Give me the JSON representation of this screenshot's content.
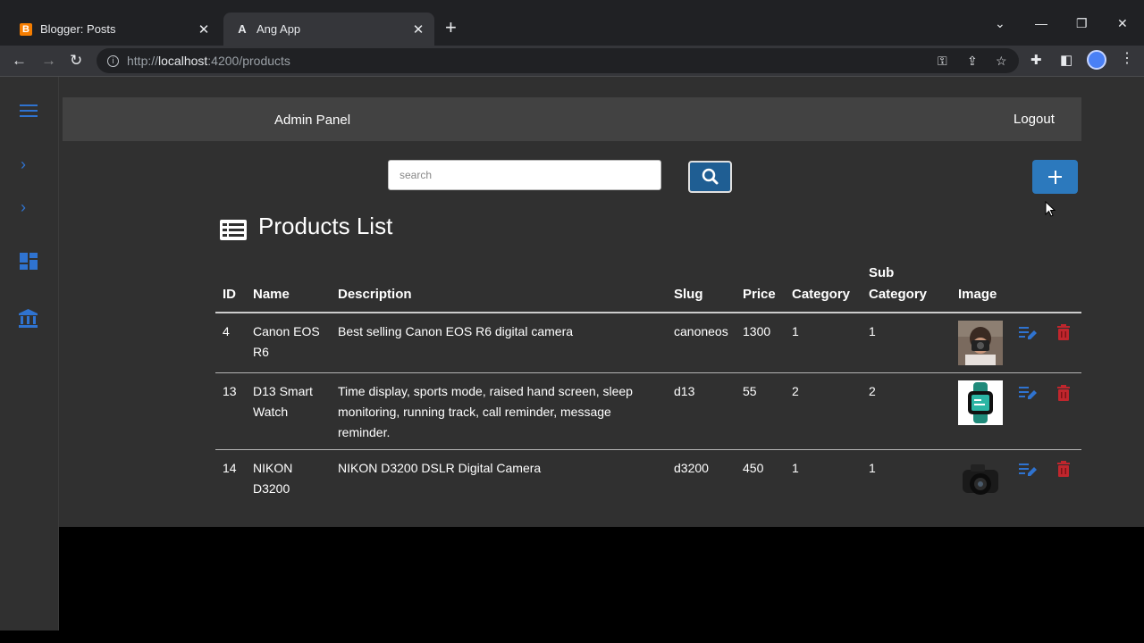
{
  "browser": {
    "tabs": [
      {
        "title": "Blogger: Posts",
        "favicon": "blogger-icon",
        "favicon_letter": "B",
        "active": false
      },
      {
        "title": "Ang App",
        "favicon": "angular-icon",
        "favicon_letter": "A",
        "active": true
      }
    ],
    "url": {
      "prefix": "http://",
      "host": "localhost",
      "rest": ":4200/products"
    }
  },
  "header": {
    "title": "Admin Panel",
    "logout": "Logout"
  },
  "search": {
    "placeholder": "search"
  },
  "page": {
    "title": "Products List"
  },
  "table": {
    "headers": {
      "id": "ID",
      "name": "Name",
      "description": "Description",
      "slug": "Slug",
      "price": "Price",
      "category": "Category",
      "subcategory_line1": "Sub",
      "subcategory_line2": "Category",
      "image": "Image"
    },
    "rows": [
      {
        "id": "4",
        "name": "Canon EOS R6",
        "description": "Best selling Canon EOS R6 digital camera",
        "slug": "canoneos",
        "price": "1300",
        "category": "1",
        "subcategory": "1",
        "image": "person-camera-photo"
      },
      {
        "id": "13",
        "name": "D13 Smart Watch",
        "description": "Time display, sports mode, raised hand screen, sleep monitoring, running track, call reminder, message reminder.",
        "slug": "d13",
        "price": "55",
        "category": "2",
        "subcategory": "2",
        "image": "smartwatch-photo"
      },
      {
        "id": "14",
        "name": "NIKON D3200",
        "description": "NIKON D3200 DSLR Digital Camera",
        "slug": "d3200",
        "price": "450",
        "category": "1",
        "subcategory": "1",
        "image": "dslr-camera-photo"
      }
    ]
  },
  "colors": {
    "accent": "#2c79bd",
    "delete": "#c0262d",
    "edit": "#2f73d0",
    "panel": "#303030",
    "header": "#424242"
  }
}
